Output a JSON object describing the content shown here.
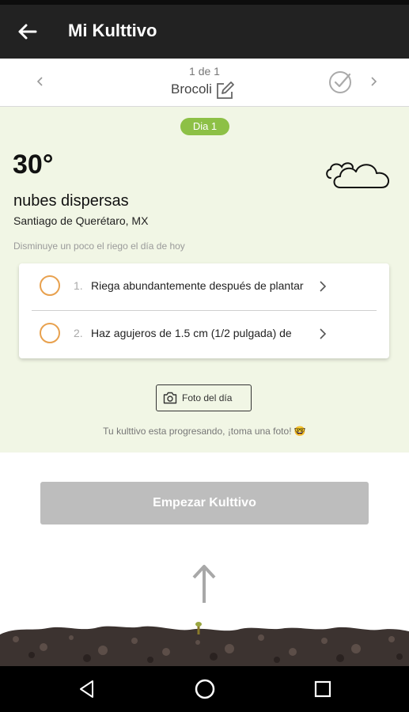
{
  "app_bar": {
    "title": "Mi Kulttivo",
    "back_icon": "back-arrow-icon"
  },
  "plant_selector": {
    "counter": "1 de 1",
    "name": "Brocoli",
    "edit_icon": "edit-icon",
    "check_icon": "check-circle-icon"
  },
  "day_badge": "Dia 1",
  "weather": {
    "temperature": "30°",
    "description": "nubes dispersas",
    "location": "Santiago de Querétaro, MX",
    "icon": "cloud-icon",
    "tip": "Disminuye un poco el riego el día de hoy"
  },
  "tasks": [
    {
      "number": "1.",
      "text": "Riega abundantemente después de plantar"
    },
    {
      "number": "2.",
      "text": "Haz agujeros de 1.5 cm (1/2 pulgada) de"
    }
  ],
  "photo_button": {
    "label": "Foto del día",
    "icon": "camera-icon"
  },
  "progress_text": "Tu kulttivo esta progresando, ¡toma una foto! 🤓",
  "start_button": {
    "label": "Empezar Kulttivo"
  },
  "colors": {
    "accent_green": "#8dc046",
    "panel_bg": "#f1f6e5",
    "task_ring": "#e8a14e",
    "disabled_button": "#bdbdbd",
    "app_bar": "#222222"
  },
  "nav": {
    "back": "nav-back-icon",
    "home": "nav-home-icon",
    "recents": "nav-recents-icon"
  }
}
